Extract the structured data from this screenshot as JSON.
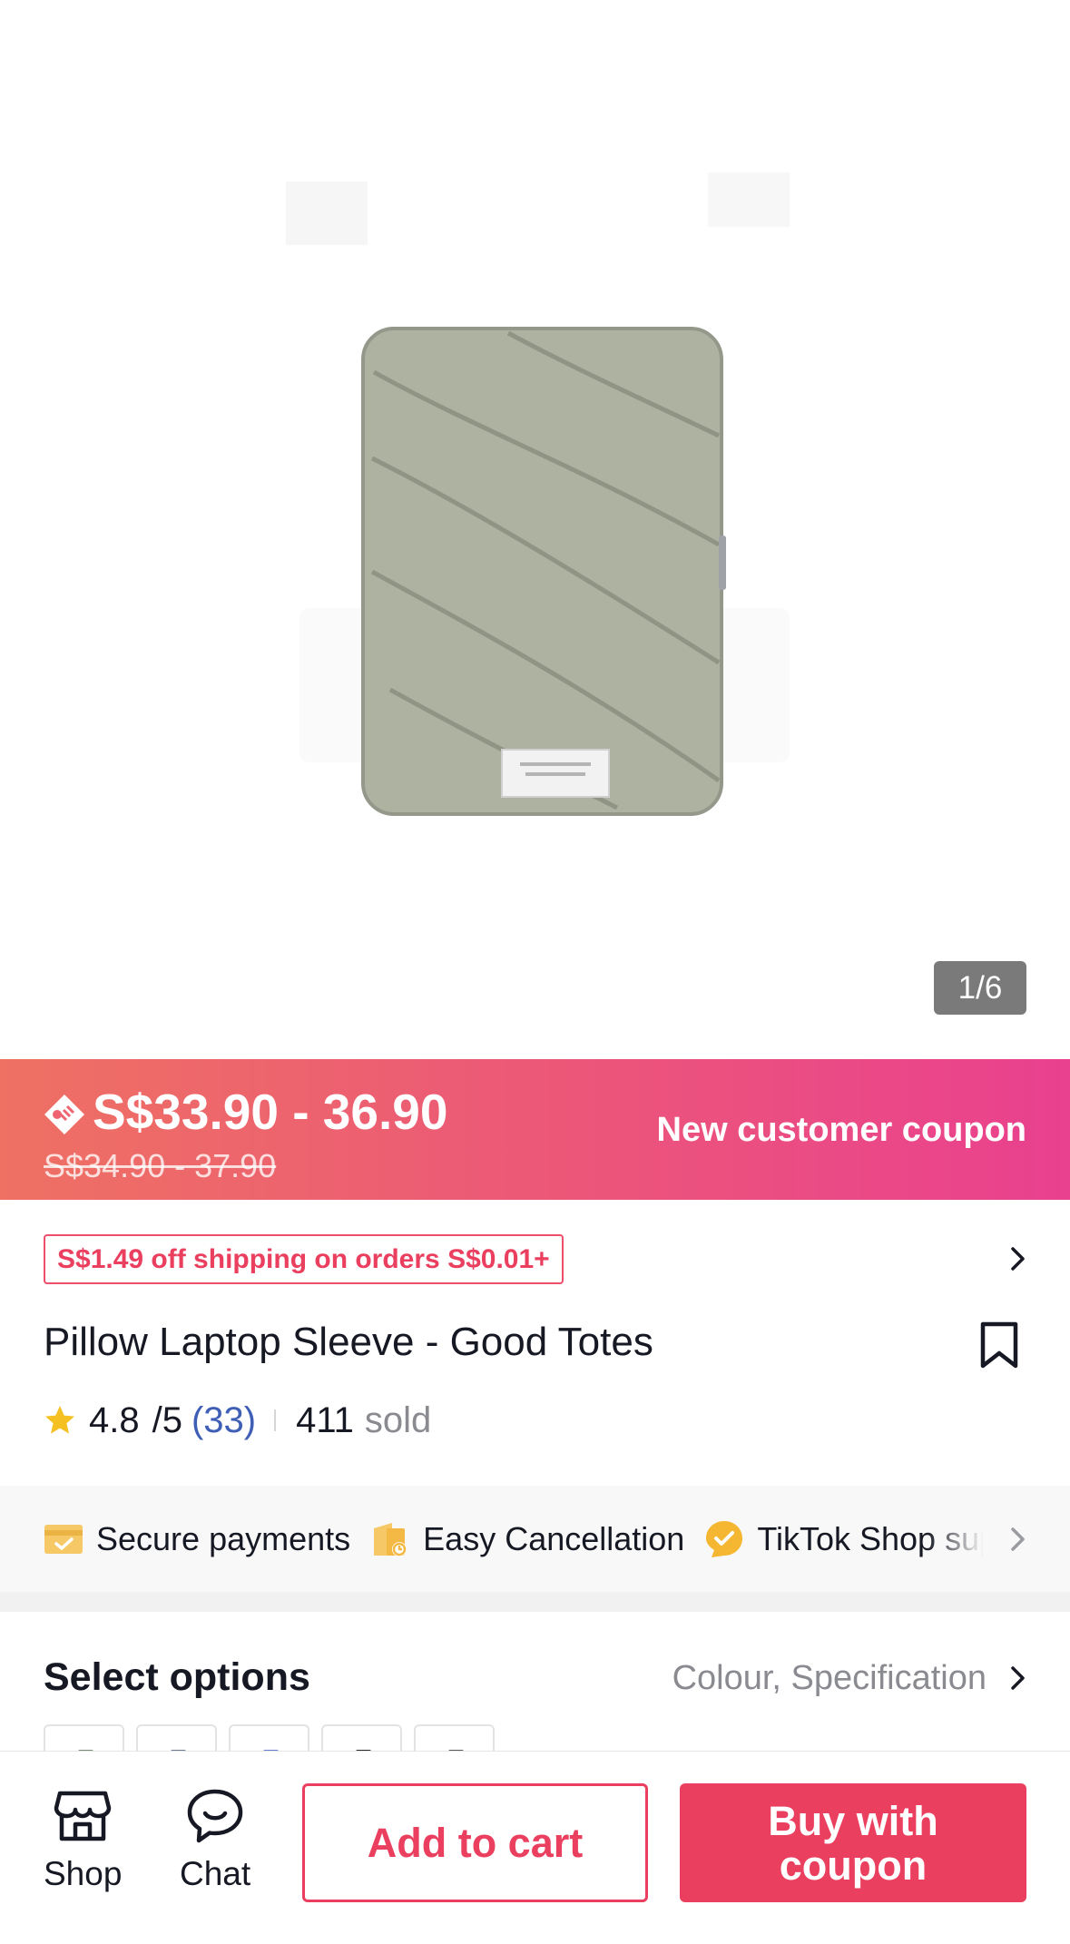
{
  "gallery": {
    "image_alt": "Pillow Laptop Sleeve product photo",
    "counter": "1/6"
  },
  "price": {
    "current": "S$33.90 - 36.90",
    "original": "S$34.90 - 37.90",
    "coupon_label": "New customer coupon"
  },
  "shipping": {
    "badge": "S$1.49 off shipping on orders S$0.01+"
  },
  "product": {
    "title": "Pillow Laptop Sleeve - Good Totes",
    "rating": "4.8",
    "rating_max": "/5",
    "review_count": "(33)",
    "sold_count": "411",
    "sold_label": "sold"
  },
  "features": [
    {
      "icon": "secure-payment-icon",
      "label": "Secure payments"
    },
    {
      "icon": "easy-cancellation-icon",
      "label": "Easy Cancellation"
    },
    {
      "icon": "tiktok-shop-icon",
      "label": "TikTok Shop support"
    }
  ],
  "options": {
    "title": "Select options",
    "summary": "Colour, Specification",
    "swatch_colors": [
      "#7d8a7a",
      "#6e7b8a",
      "#6b7bd0",
      "#2a2a2a",
      "#5a5a5a"
    ]
  },
  "bottom_bar": {
    "shop_label": "Shop",
    "chat_label": "Chat",
    "add_to_cart": "Add to cart",
    "buy_with_coupon": "Buy with coupon"
  },
  "colors": {
    "accent": "#ea3f5e",
    "price_gradient_start": "#ee7163",
    "price_gradient_end": "#e9408f",
    "link_blue": "#3f5fb7",
    "star": "#f5c022"
  }
}
